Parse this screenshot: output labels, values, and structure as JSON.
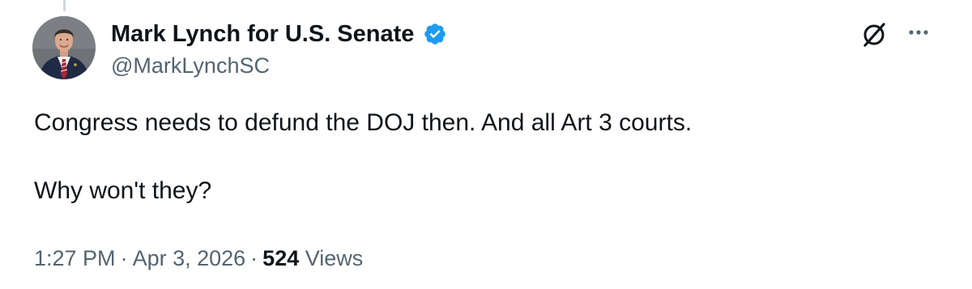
{
  "author": {
    "display_name": "Mark Lynch for U.S. Senate",
    "handle": "@MarkLynchSC",
    "verified": true,
    "verified_color": "#1d9bf0"
  },
  "tweet": {
    "lines": [
      "Congress needs to defund the DOJ then. And all Art 3 courts.",
      "Why won't they?"
    ]
  },
  "meta": {
    "time": "1:27 PM",
    "separator": "·",
    "date": "Apr 3, 2026",
    "views_count": "524",
    "views_label": "Views"
  },
  "icons": {
    "grok": "grok-icon",
    "more": "more-horizontal-icon",
    "verified": "verified-badge-icon"
  },
  "colors": {
    "text_primary": "#0f1419",
    "text_secondary": "#536471",
    "thread_line": "#cfd9de",
    "background": "#ffffff"
  }
}
